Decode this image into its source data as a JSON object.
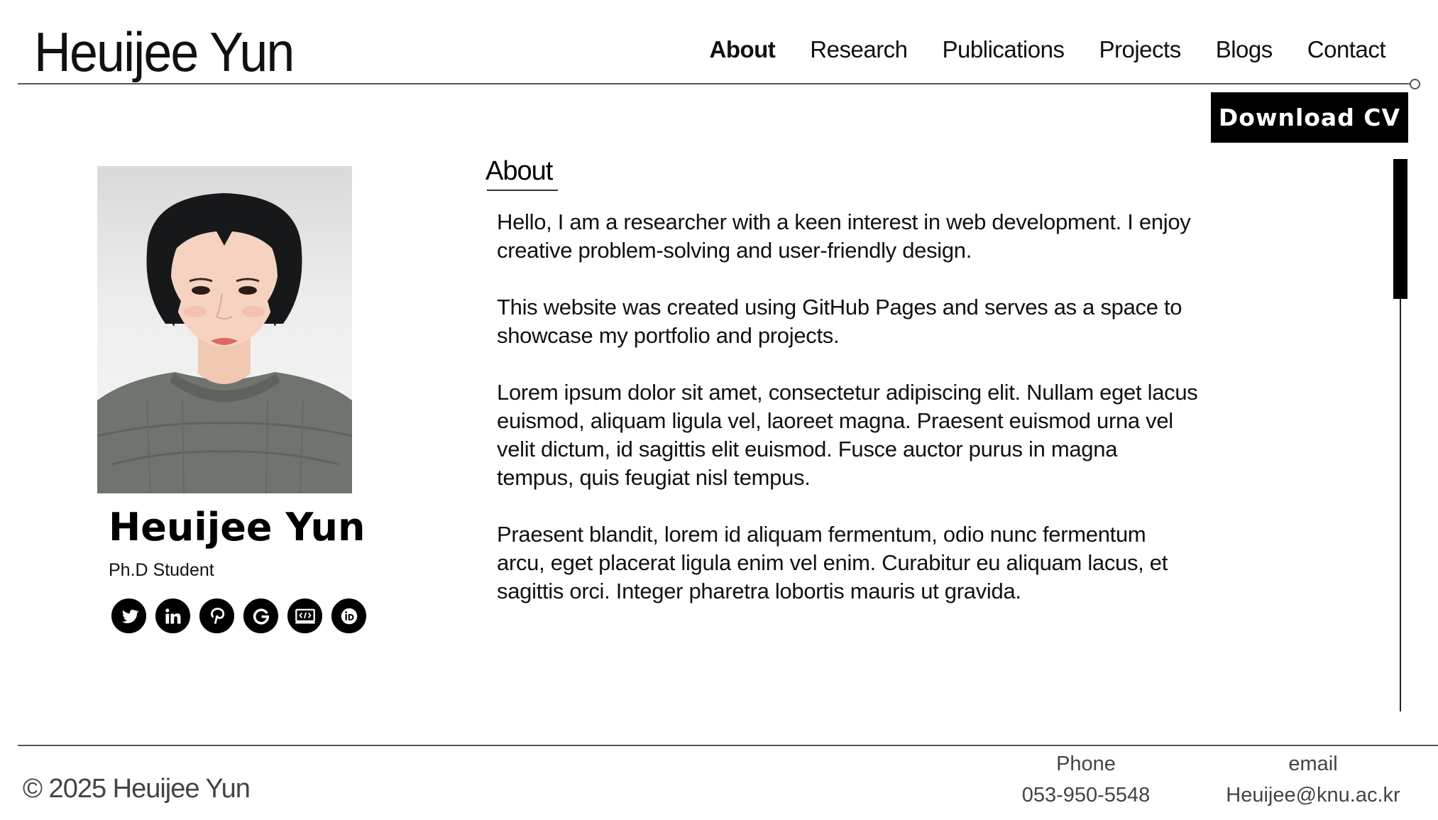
{
  "header": {
    "site_title": "Heuijee Yun",
    "nav": [
      {
        "label": "About",
        "active": true
      },
      {
        "label": "Research",
        "active": false
      },
      {
        "label": "Publications",
        "active": false
      },
      {
        "label": "Projects",
        "active": false
      },
      {
        "label": "Blogs",
        "active": false
      },
      {
        "label": "Contact",
        "active": false
      }
    ]
  },
  "cv_button": {
    "label": "Download CV"
  },
  "profile": {
    "name": "Heuijee Yun",
    "role": "Ph.D Student",
    "socials": [
      "twitter-icon",
      "linkedin-icon",
      "pinterest-icon",
      "google-icon",
      "scholar-icon",
      "orcid-icon"
    ]
  },
  "about": {
    "heading": "About",
    "paragraphs": [
      "Hello, I am a researcher with a keen interest in web development. I enjoy creative problem-solving and user-friendly design.",
      "This website was created using GitHub Pages and serves as a space to showcase my portfolio and projects.",
      "Lorem ipsum dolor sit amet, consectetur adipiscing elit. Nullam eget lacus euismod, aliquam ligula vel, laoreet magna. Praesent euismod urna vel velit dictum, id sagittis elit euismod. Fusce auctor purus in magna tempus, quis feugiat nisl tempus.",
      "Praesent blandit, lorem id aliquam fermentum, odio nunc fermentum arcu, eget placerat ligula enim vel enim. Curabitur eu aliquam lacus, et sagittis orci. Integer pharetra lobortis mauris ut gravida."
    ]
  },
  "footer": {
    "copyright": "© 2025 Heuijee Yun",
    "phone_label": "Phone",
    "phone_value": "053-950-5548",
    "email_label": "email",
    "email_value": "Heuijee@knu.ac.kr"
  }
}
